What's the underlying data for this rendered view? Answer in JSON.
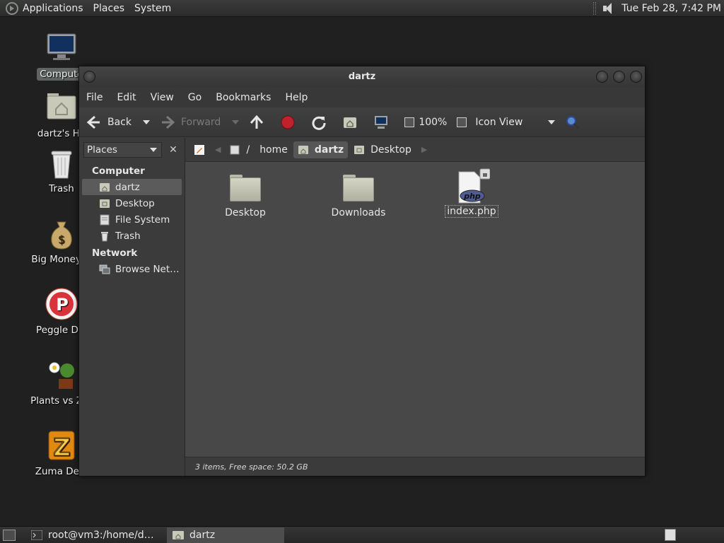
{
  "top_panel": {
    "menus": [
      "Applications",
      "Places",
      "System"
    ],
    "clock": "Tue Feb 28,  7:42 PM"
  },
  "desktop_icons": [
    {
      "label": "Compute",
      "icon": "computer-icon"
    },
    {
      "label": "dartz's Ho",
      "icon": "home-folder-icon"
    },
    {
      "label": "Trash",
      "icon": "trash-icon"
    },
    {
      "label": "Big Money D",
      "icon": "money-bag-icon"
    },
    {
      "label": "Peggle Del",
      "icon": "peggle-icon"
    },
    {
      "label": "Plants vs Zor",
      "icon": "plants-icon"
    },
    {
      "label": "Zuma Delu",
      "icon": "zuma-icon"
    }
  ],
  "window": {
    "title": "dartz",
    "menus": [
      "File",
      "Edit",
      "View",
      "Go",
      "Bookmarks",
      "Help"
    ],
    "toolbar": {
      "back": "Back",
      "forward": "Forward",
      "zoom": "100%",
      "view_mode": "Icon View"
    },
    "sidebar": {
      "selector": "Places",
      "sections": [
        {
          "title": "Computer",
          "items": [
            "dartz",
            "Desktop",
            "File System",
            "Trash"
          ]
        },
        {
          "title": "Network",
          "items": [
            "Browse Net…"
          ]
        }
      ]
    },
    "pathbar": [
      "/",
      "home",
      "dartz",
      "Desktop"
    ],
    "files": [
      {
        "name": "Desktop",
        "type": "folder"
      },
      {
        "name": "Downloads",
        "type": "folder"
      },
      {
        "name": "index.php",
        "type": "php"
      }
    ],
    "status": "3 items, Free space: 50.2 GB"
  },
  "taskbar": {
    "tasks": [
      "root@vm3:/home/d…",
      "dartz"
    ]
  }
}
